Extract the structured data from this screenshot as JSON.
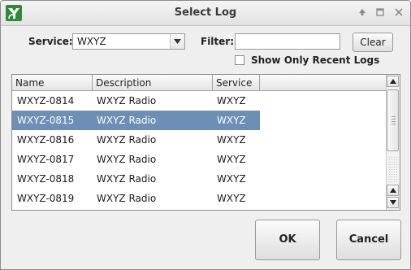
{
  "window": {
    "title": "Select Log"
  },
  "service": {
    "label": "Service:",
    "selected": "WXYZ"
  },
  "filter": {
    "label": "Filter:",
    "value": "",
    "placeholder": ""
  },
  "clear_button": {
    "label": "Clear"
  },
  "recent": {
    "label": "Show Only Recent Logs",
    "checked": false
  },
  "table": {
    "columns": [
      "Name",
      "Description",
      "Service"
    ],
    "rows": [
      {
        "name": "WXYZ-0814",
        "description": "WXYZ Radio",
        "service": "WXYZ",
        "selected": false
      },
      {
        "name": "WXYZ-0815",
        "description": "WXYZ Radio",
        "service": "WXYZ",
        "selected": true
      },
      {
        "name": "WXYZ-0816",
        "description": "WXYZ Radio",
        "service": "WXYZ",
        "selected": false
      },
      {
        "name": "WXYZ-0817",
        "description": "WXYZ Radio",
        "service": "WXYZ",
        "selected": false
      },
      {
        "name": "WXYZ-0818",
        "description": "WXYZ Radio",
        "service": "WXYZ",
        "selected": false
      },
      {
        "name": "WXYZ-0819",
        "description": "WXYZ Radio",
        "service": "WXYZ",
        "selected": false
      }
    ]
  },
  "buttons": {
    "ok": "OK",
    "cancel": "Cancel"
  },
  "colors": {
    "selection": "#6d8fb5",
    "app_icon": "#2e8b3a"
  }
}
